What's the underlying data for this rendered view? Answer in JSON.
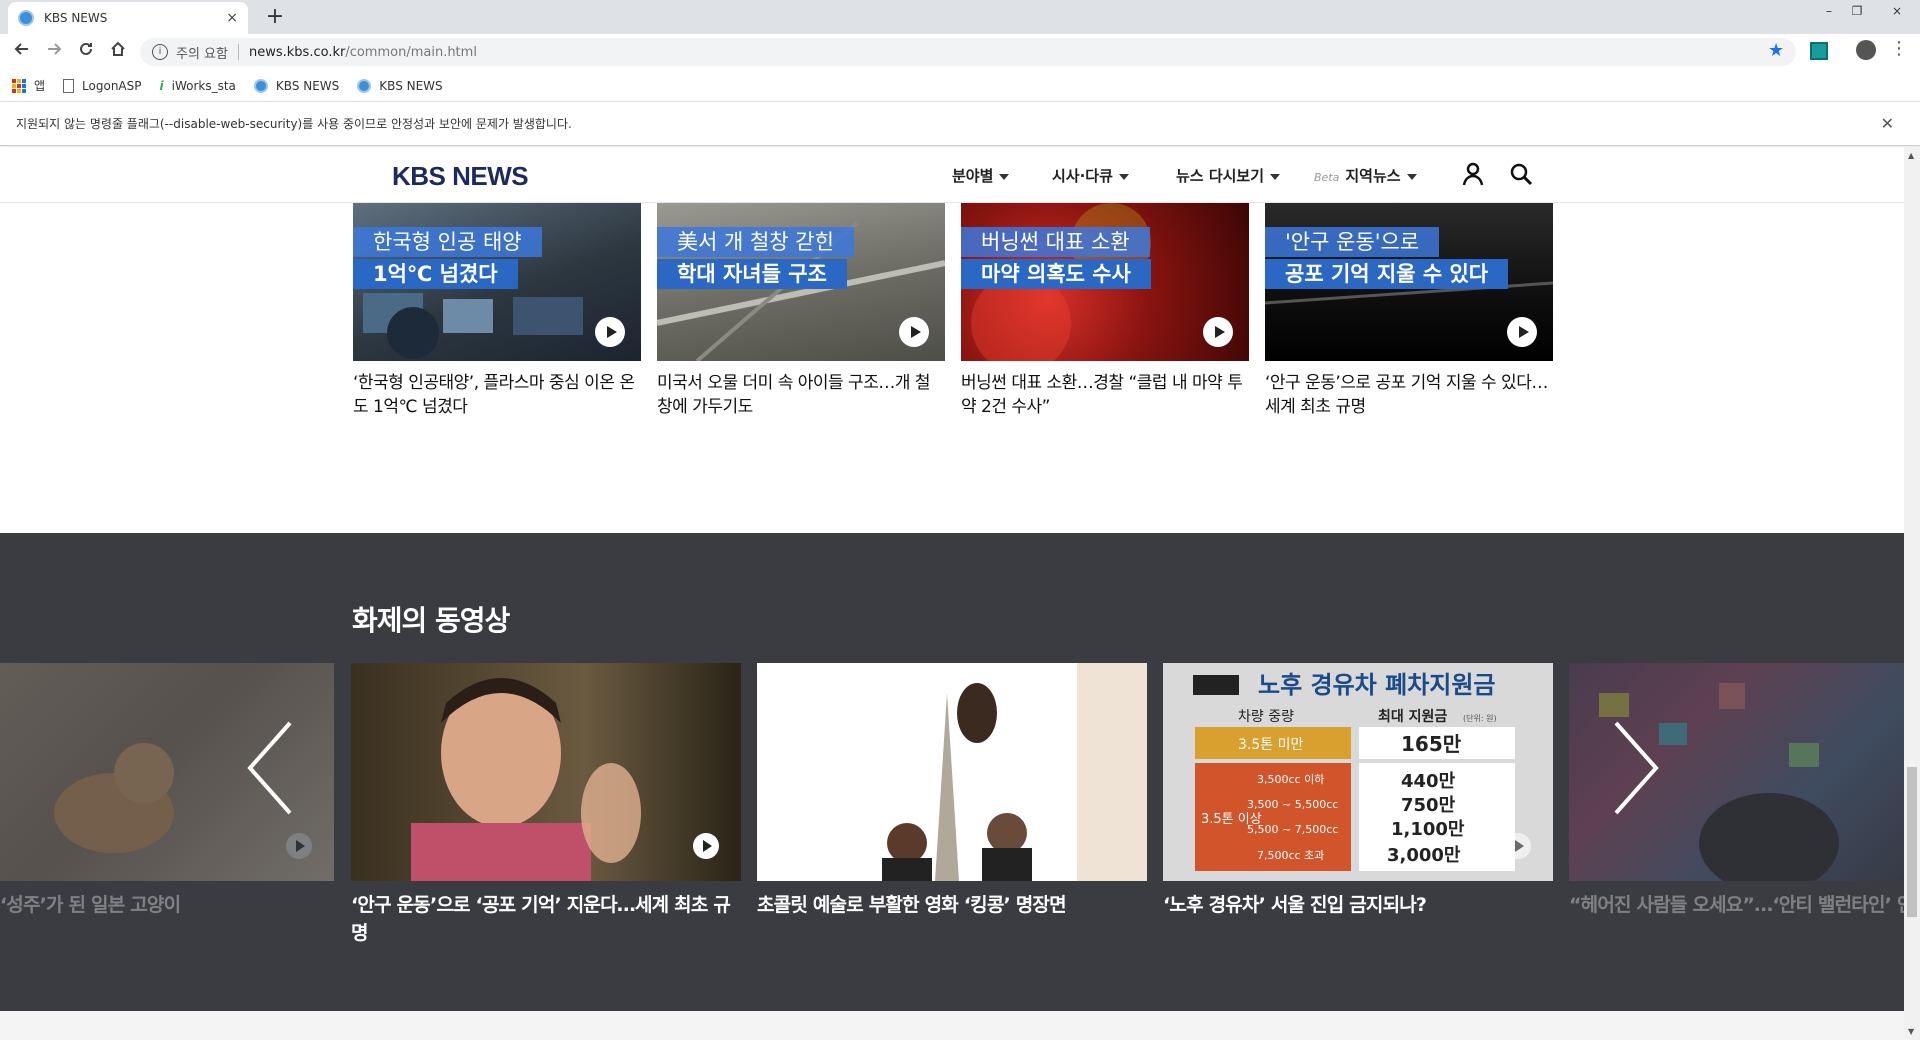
{
  "browser": {
    "tab_title": "KBS NEWS",
    "tab_close": "×",
    "new_tab": "+",
    "win_min": "–",
    "win_max": "❐",
    "win_close": "×",
    "security_warning": "주의 요함",
    "url_host": "news.kbs.co.kr",
    "url_path": "/common/main.html",
    "bookmarks": [
      {
        "label": "앱",
        "icon": "apps-icon"
      },
      {
        "label": "LogonASP",
        "icon": "document-icon"
      },
      {
        "label": "iWorks_sta",
        "icon": "iworks-icon"
      },
      {
        "label": "KBS NEWS",
        "icon": "kbs-icon"
      },
      {
        "label": "KBS NEWS",
        "icon": "kbs-icon"
      }
    ],
    "infobar_text": "지원되지 않는 명령줄 플래그(--disable-web-security)를 사용 중이므로 안정성과 보안에 문제가 발생합니다."
  },
  "site": {
    "logo": "KBS NEWS",
    "menu": [
      {
        "label": "분야별"
      },
      {
        "label": "시사·다큐"
      },
      {
        "label": "뉴스 다시보기"
      },
      {
        "label": "지역뉴스",
        "badge": "Beta"
      }
    ]
  },
  "news": [
    {
      "cap1": "한국형 인공 태양",
      "cap2": "1억℃ 넘겼다",
      "title": "‘한국형 인공태양’, 플라스마 중심 이온 온도 1억℃ 넘겼다"
    },
    {
      "cap1": "美서 개 철창 갇힌",
      "cap2": "학대 자녀들 구조",
      "title": "미국서 오물 더미 속 아이들 구조…개 철창에 가두기도"
    },
    {
      "cap1": "버닝썬 대표 소환",
      "cap2": "마약 의혹도 수사",
      "title": "버닝썬 대표 소환…경찰 “클럽 내 마약 투약 2건 수사”"
    },
    {
      "cap1": "'안구 운동'으로",
      "cap2": "공포 기억 지울 수 있다",
      "title": "‘안구 운동’으로 공포 기억 지울 수 있다…세계 최초 규명"
    }
  ],
  "trending": {
    "heading": "화제의 동영상",
    "videos": [
      {
        "title": "이에서 ‘성주’가 된 일본 고양이"
      },
      {
        "title": "‘안구 운동’으로 ‘공포 기억’ 지운다…세계 최초 규명"
      },
      {
        "title": "초콜릿 예술로 부활한 영화 ‘킹콩’ 명장면"
      },
      {
        "title": "‘노후 경유차’ 서울 진입 금지되나?"
      },
      {
        "title": "“헤어진 사람들 오세요”…‘안티 밸런타인’ 인기"
      }
    ],
    "infographic": {
      "title": "노후 경유차 폐차지원금",
      "col1": "차량 중량",
      "col2": "최대 지원금",
      "col2_unit": "(단위: 원)",
      "rows": [
        {
          "weight": "3.5톤 미만",
          "amount": "165만"
        },
        {
          "weight": "3,500cc 이하",
          "amount": "440만"
        },
        {
          "weight": "3,500 ~ 5,500cc",
          "amount": "750만"
        },
        {
          "weight": "5,500 ~ 7,500cc",
          "amount": "1,100만"
        },
        {
          "weight": "7,500cc 초과",
          "amount": "3,000만"
        }
      ],
      "group_label": "3.5톤 이상"
    }
  },
  "colors": {
    "brand": "#1d2a5d",
    "caption_blue": "#2a68c4",
    "trend_bg": "#3a3c41"
  }
}
